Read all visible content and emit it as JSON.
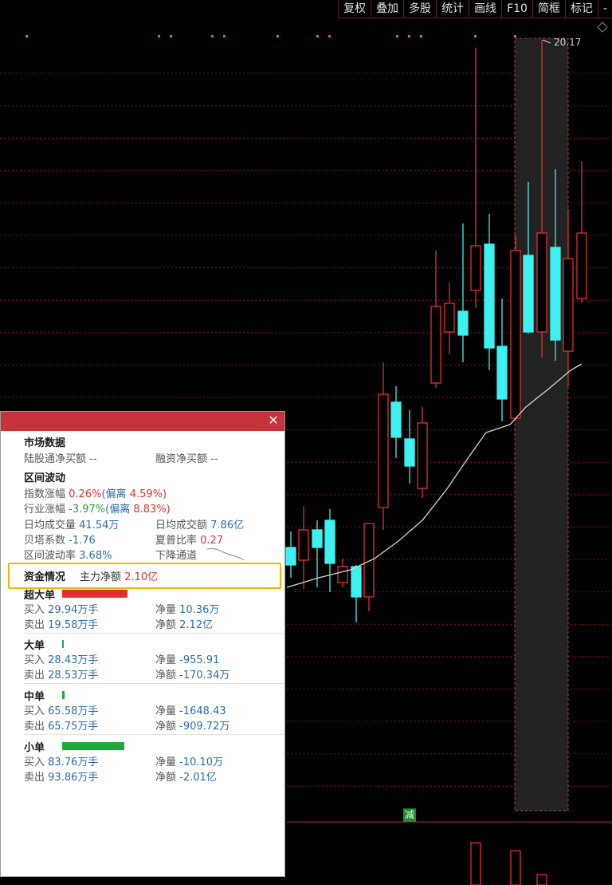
{
  "toolbar": {
    "items": [
      "复权",
      "叠加",
      "多股",
      "统计",
      "画线",
      "F10",
      "简框",
      "标记",
      "-"
    ]
  },
  "chart": {
    "price_marker": "20.17",
    "reduce_marker": "减",
    "partial_label": "线",
    "colors": {
      "up": "#e03030",
      "down": "#3ff0f0",
      "ma": "#d8d8d8",
      "grid": "#8a1010"
    }
  },
  "panel": {
    "market": {
      "title": "市场数据",
      "hk_label": "陆股通净买额",
      "hk_value": "--",
      "margin_label": "融资净买额",
      "margin_value": "--"
    },
    "interval": {
      "title": "区间波动",
      "index_label": "指数涨幅",
      "index_value": "0.26%",
      "index_dev_label": "(偏离",
      "index_dev_value": "4.59%)",
      "ind_label": "行业涨幅",
      "ind_value": "-3.97%",
      "ind_dev_label": "(偏离",
      "ind_dev_value": "8.83%)",
      "vol_label": "日均成交量",
      "vol_value": "41.54万",
      "amt_label": "日均成交额",
      "amt_value": "7.86亿",
      "beta_label": "贝塔系数",
      "beta_value": "-1.76",
      "sharpe_label": "夏普比率",
      "sharpe_value": "0.27",
      "volatility_label": "区间波动率",
      "volatility_value": "3.68%",
      "trend": "下降通道"
    },
    "capital": {
      "title": "资金情况",
      "main_label": "主力净额",
      "main_value": "2.10亿"
    },
    "orders": [
      {
        "title": "超大单",
        "bar_ratio": 1.0,
        "buy_label": "买入",
        "buy_value": "29.94万手",
        "net_label": "净量",
        "net_value": "10.36万",
        "sell_label": "卖出",
        "sell_value": "19.58万手",
        "amt_label": "净额",
        "amt_value": "2.12亿"
      },
      {
        "title": "大单",
        "bar_ratio": 0.02,
        "buy_label": "买入",
        "buy_value": "28.43万手",
        "net_label": "净量",
        "net_value": "-955.91",
        "sell_label": "卖出",
        "sell_value": "28.53万手",
        "amt_label": "净额",
        "amt_value": "-170.34万"
      },
      {
        "title": "中单",
        "bar_ratio": 0.04,
        "buy_label": "买入",
        "buy_value": "65.58万手",
        "net_label": "净量",
        "net_value": "-1648.43",
        "sell_label": "卖出",
        "sell_value": "65.75万手",
        "amt_label": "净额",
        "amt_value": "-909.72万"
      },
      {
        "title": "小单",
        "bar_ratio": 0.95,
        "buy_label": "买入",
        "buy_value": "83.76万手",
        "net_label": "净量",
        "net_value": "-10.10万",
        "sell_label": "卖出",
        "sell_value": "93.86万手",
        "amt_label": "净额",
        "amt_value": "-2.01亿"
      }
    ]
  }
}
